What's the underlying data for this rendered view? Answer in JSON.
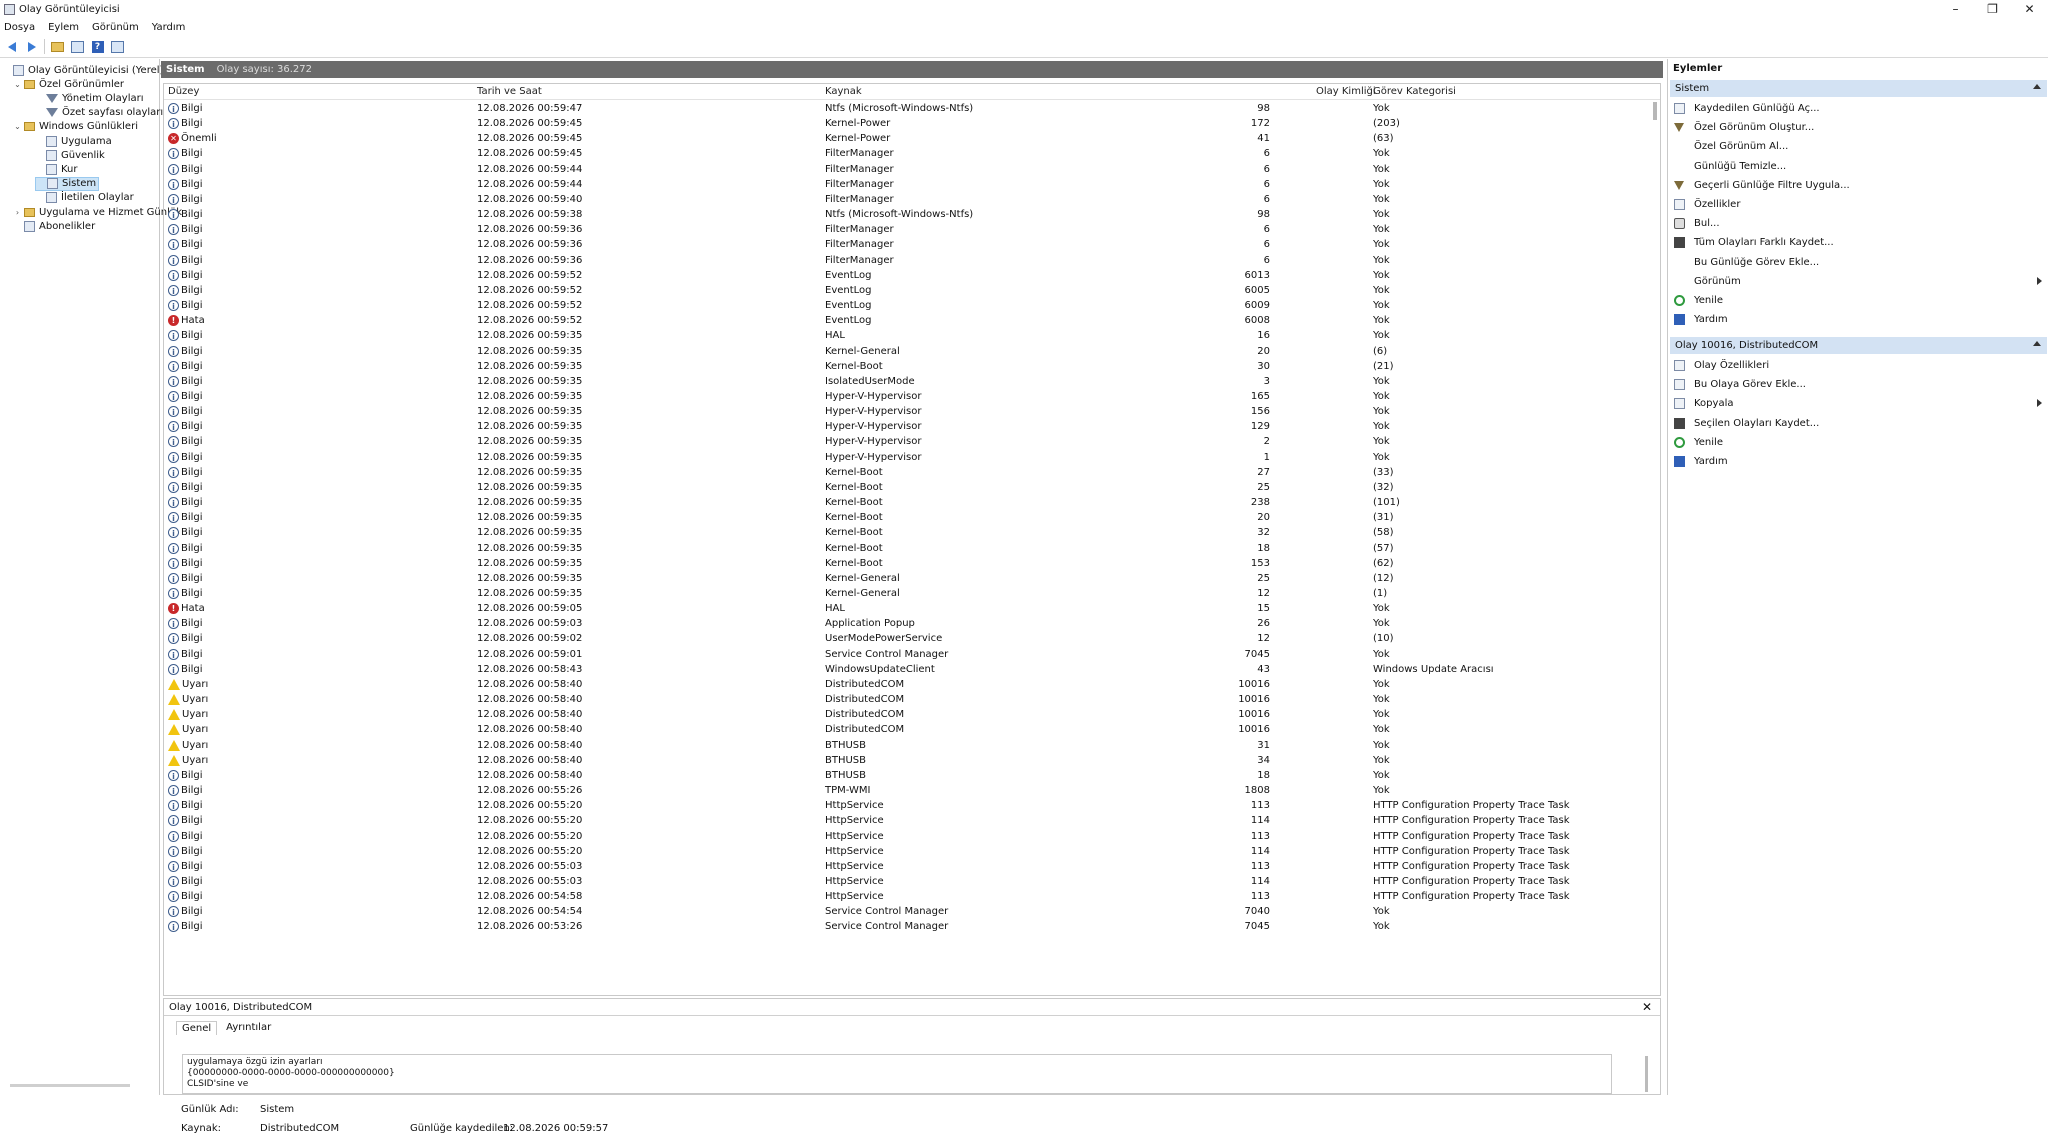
{
  "window": {
    "title": "Olay Görüntüleyicisi",
    "minimize": "–",
    "maximize": "❐",
    "close": "✕"
  },
  "menu": [
    "Dosya",
    "Eylem",
    "Görünüm",
    "Yardım"
  ],
  "tree": [
    {
      "label": "Olay Görüntüleyicisi (Yerel)",
      "indent": 0,
      "exp": "",
      "icon": "doc"
    },
    {
      "label": "Özel Görünümler",
      "indent": 1,
      "exp": "⌄",
      "icon": "folder"
    },
    {
      "label": "Yönetim Olayları",
      "indent": 3,
      "exp": "",
      "icon": "filter"
    },
    {
      "label": "Özet sayfası olayları",
      "indent": 3,
      "exp": "",
      "icon": "filter"
    },
    {
      "label": "Windows Günlükleri",
      "indent": 1,
      "exp": "⌄",
      "icon": "folder"
    },
    {
      "label": "Uygulama",
      "indent": 3,
      "exp": "",
      "icon": "doc"
    },
    {
      "label": "Güvenlik",
      "indent": 3,
      "exp": "",
      "icon": "doc"
    },
    {
      "label": "Kur",
      "indent": 3,
      "exp": "",
      "icon": "doc"
    },
    {
      "label": "Sistem",
      "indent": 3,
      "exp": "",
      "icon": "doc",
      "selected": true
    },
    {
      "label": "İletilen Olaylar",
      "indent": 3,
      "exp": "",
      "icon": "doc"
    },
    {
      "label": "Uygulama ve Hizmet Günlük",
      "indent": 1,
      "exp": "›",
      "icon": "folder"
    },
    {
      "label": "Abonelikler",
      "indent": 1,
      "exp": "",
      "icon": "doc"
    }
  ],
  "center": {
    "header_title": "Sistem",
    "header_count": "Olay sayısı: 36.272"
  },
  "columns": {
    "level": "Düzey",
    "date": "Tarih ve Saat",
    "source": "Kaynak",
    "id": "Olay Kimliği",
    "category": "Görev Kategorisi"
  },
  "events": [
    {
      "t": "info",
      "level": "Bilgi",
      "date": "12.08.2026 00:59:47",
      "source": "Ntfs (Microsoft-Windows-Ntfs)",
      "id": "98",
      "cat": "Yok"
    },
    {
      "t": "info",
      "level": "Bilgi",
      "date": "12.08.2026 00:59:45",
      "source": "Kernel-Power",
      "id": "172",
      "cat": "(203)"
    },
    {
      "t": "crit",
      "level": "Önemli",
      "date": "12.08.2026 00:59:45",
      "source": "Kernel-Power",
      "id": "41",
      "cat": "(63)"
    },
    {
      "t": "info",
      "level": "Bilgi",
      "date": "12.08.2026 00:59:45",
      "source": "FilterManager",
      "id": "6",
      "cat": "Yok"
    },
    {
      "t": "info",
      "level": "Bilgi",
      "date": "12.08.2026 00:59:44",
      "source": "FilterManager",
      "id": "6",
      "cat": "Yok"
    },
    {
      "t": "info",
      "level": "Bilgi",
      "date": "12.08.2026 00:59:44",
      "source": "FilterManager",
      "id": "6",
      "cat": "Yok"
    },
    {
      "t": "info",
      "level": "Bilgi",
      "date": "12.08.2026 00:59:40",
      "source": "FilterManager",
      "id": "6",
      "cat": "Yok"
    },
    {
      "t": "info",
      "level": "Bilgi",
      "date": "12.08.2026 00:59:38",
      "source": "Ntfs (Microsoft-Windows-Ntfs)",
      "id": "98",
      "cat": "Yok"
    },
    {
      "t": "info",
      "level": "Bilgi",
      "date": "12.08.2026 00:59:36",
      "source": "FilterManager",
      "id": "6",
      "cat": "Yok"
    },
    {
      "t": "info",
      "level": "Bilgi",
      "date": "12.08.2026 00:59:36",
      "source": "FilterManager",
      "id": "6",
      "cat": "Yok"
    },
    {
      "t": "info",
      "level": "Bilgi",
      "date": "12.08.2026 00:59:36",
      "source": "FilterManager",
      "id": "6",
      "cat": "Yok"
    },
    {
      "t": "info",
      "level": "Bilgi",
      "date": "12.08.2026 00:59:52",
      "source": "EventLog",
      "id": "6013",
      "cat": "Yok"
    },
    {
      "t": "info",
      "level": "Bilgi",
      "date": "12.08.2026 00:59:52",
      "source": "EventLog",
      "id": "6005",
      "cat": "Yok"
    },
    {
      "t": "info",
      "level": "Bilgi",
      "date": "12.08.2026 00:59:52",
      "source": "EventLog",
      "id": "6009",
      "cat": "Yok"
    },
    {
      "t": "err",
      "level": "Hata",
      "date": "12.08.2026 00:59:52",
      "source": "EventLog",
      "id": "6008",
      "cat": "Yok"
    },
    {
      "t": "info",
      "level": "Bilgi",
      "date": "12.08.2026 00:59:35",
      "source": "HAL",
      "id": "16",
      "cat": "Yok"
    },
    {
      "t": "info",
      "level": "Bilgi",
      "date": "12.08.2026 00:59:35",
      "source": "Kernel-General",
      "id": "20",
      "cat": "(6)"
    },
    {
      "t": "info",
      "level": "Bilgi",
      "date": "12.08.2026 00:59:35",
      "source": "Kernel-Boot",
      "id": "30",
      "cat": "(21)"
    },
    {
      "t": "info",
      "level": "Bilgi",
      "date": "12.08.2026 00:59:35",
      "source": "IsolatedUserMode",
      "id": "3",
      "cat": "Yok"
    },
    {
      "t": "info",
      "level": "Bilgi",
      "date": "12.08.2026 00:59:35",
      "source": "Hyper-V-Hypervisor",
      "id": "165",
      "cat": "Yok"
    },
    {
      "t": "info",
      "level": "Bilgi",
      "date": "12.08.2026 00:59:35",
      "source": "Hyper-V-Hypervisor",
      "id": "156",
      "cat": "Yok"
    },
    {
      "t": "info",
      "level": "Bilgi",
      "date": "12.08.2026 00:59:35",
      "source": "Hyper-V-Hypervisor",
      "id": "129",
      "cat": "Yok"
    },
    {
      "t": "info",
      "level": "Bilgi",
      "date": "12.08.2026 00:59:35",
      "source": "Hyper-V-Hypervisor",
      "id": "2",
      "cat": "Yok"
    },
    {
      "t": "info",
      "level": "Bilgi",
      "date": "12.08.2026 00:59:35",
      "source": "Hyper-V-Hypervisor",
      "id": "1",
      "cat": "Yok"
    },
    {
      "t": "info",
      "level": "Bilgi",
      "date": "12.08.2026 00:59:35",
      "source": "Kernel-Boot",
      "id": "27",
      "cat": "(33)"
    },
    {
      "t": "info",
      "level": "Bilgi",
      "date": "12.08.2026 00:59:35",
      "source": "Kernel-Boot",
      "id": "25",
      "cat": "(32)"
    },
    {
      "t": "info",
      "level": "Bilgi",
      "date": "12.08.2026 00:59:35",
      "source": "Kernel-Boot",
      "id": "238",
      "cat": "(101)"
    },
    {
      "t": "info",
      "level": "Bilgi",
      "date": "12.08.2026 00:59:35",
      "source": "Kernel-Boot",
      "id": "20",
      "cat": "(31)"
    },
    {
      "t": "info",
      "level": "Bilgi",
      "date": "12.08.2026 00:59:35",
      "source": "Kernel-Boot",
      "id": "32",
      "cat": "(58)"
    },
    {
      "t": "info",
      "level": "Bilgi",
      "date": "12.08.2026 00:59:35",
      "source": "Kernel-Boot",
      "id": "18",
      "cat": "(57)"
    },
    {
      "t": "info",
      "level": "Bilgi",
      "date": "12.08.2026 00:59:35",
      "source": "Kernel-Boot",
      "id": "153",
      "cat": "(62)"
    },
    {
      "t": "info",
      "level": "Bilgi",
      "date": "12.08.2026 00:59:35",
      "source": "Kernel-General",
      "id": "25",
      "cat": "(12)"
    },
    {
      "t": "info",
      "level": "Bilgi",
      "date": "12.08.2026 00:59:35",
      "source": "Kernel-General",
      "id": "12",
      "cat": "(1)"
    },
    {
      "t": "err",
      "level": "Hata",
      "date": "12.08.2026 00:59:05",
      "source": "HAL",
      "id": "15",
      "cat": "Yok"
    },
    {
      "t": "info",
      "level": "Bilgi",
      "date": "12.08.2026 00:59:03",
      "source": "Application Popup",
      "id": "26",
      "cat": "Yok"
    },
    {
      "t": "info",
      "level": "Bilgi",
      "date": "12.08.2026 00:59:02",
      "source": "UserModePowerService",
      "id": "12",
      "cat": "(10)"
    },
    {
      "t": "info",
      "level": "Bilgi",
      "date": "12.08.2026 00:59:01",
      "source": "Service Control Manager",
      "id": "7045",
      "cat": "Yok"
    },
    {
      "t": "info",
      "level": "Bilgi",
      "date": "12.08.2026 00:58:43",
      "source": "WindowsUpdateClient",
      "id": "43",
      "cat": "Windows Update Aracısı"
    },
    {
      "t": "warn",
      "level": "Uyarı",
      "date": "12.08.2026 00:58:40",
      "source": "DistributedCOM",
      "id": "10016",
      "cat": "Yok"
    },
    {
      "t": "warn",
      "level": "Uyarı",
      "date": "12.08.2026 00:58:40",
      "source": "DistributedCOM",
      "id": "10016",
      "cat": "Yok"
    },
    {
      "t": "warn",
      "level": "Uyarı",
      "date": "12.08.2026 00:58:40",
      "source": "DistributedCOM",
      "id": "10016",
      "cat": "Yok"
    },
    {
      "t": "warn",
      "level": "Uyarı",
      "date": "12.08.2026 00:58:40",
      "source": "DistributedCOM",
      "id": "10016",
      "cat": "Yok"
    },
    {
      "t": "warn",
      "level": "Uyarı",
      "date": "12.08.2026 00:58:40",
      "source": "BTHUSB",
      "id": "31",
      "cat": "Yok"
    },
    {
      "t": "warn",
      "level": "Uyarı",
      "date": "12.08.2026 00:58:40",
      "source": "BTHUSB",
      "id": "34",
      "cat": "Yok"
    },
    {
      "t": "info",
      "level": "Bilgi",
      "date": "12.08.2026 00:58:40",
      "source": "BTHUSB",
      "id": "18",
      "cat": "Yok"
    },
    {
      "t": "info",
      "level": "Bilgi",
      "date": "12.08.2026 00:55:26",
      "source": "TPM-WMI",
      "id": "1808",
      "cat": "Yok"
    },
    {
      "t": "info",
      "level": "Bilgi",
      "date": "12.08.2026 00:55:20",
      "source": "HttpService",
      "id": "113",
      "cat": "HTTP Configuration Property Trace Task"
    },
    {
      "t": "info",
      "level": "Bilgi",
      "date": "12.08.2026 00:55:20",
      "source": "HttpService",
      "id": "114",
      "cat": "HTTP Configuration Property Trace Task"
    },
    {
      "t": "info",
      "level": "Bilgi",
      "date": "12.08.2026 00:55:20",
      "source": "HttpService",
      "id": "113",
      "cat": "HTTP Configuration Property Trace Task"
    },
    {
      "t": "info",
      "level": "Bilgi",
      "date": "12.08.2026 00:55:20",
      "source": "HttpService",
      "id": "114",
      "cat": "HTTP Configuration Property Trace Task"
    },
    {
      "t": "info",
      "level": "Bilgi",
      "date": "12.08.2026 00:55:03",
      "source": "HttpService",
      "id": "113",
      "cat": "HTTP Configuration Property Trace Task"
    },
    {
      "t": "info",
      "level": "Bilgi",
      "date": "12.08.2026 00:55:03",
      "source": "HttpService",
      "id": "114",
      "cat": "HTTP Configuration Property Trace Task"
    },
    {
      "t": "info",
      "level": "Bilgi",
      "date": "12.08.2026 00:54:58",
      "source": "HttpService",
      "id": "113",
      "cat": "HTTP Configuration Property Trace Task"
    },
    {
      "t": "info",
      "level": "Bilgi",
      "date": "12.08.2026 00:54:54",
      "source": "Service Control Manager",
      "id": "7040",
      "cat": "Yok"
    },
    {
      "t": "info",
      "level": "Bilgi",
      "date": "12.08.2026 00:53:26",
      "source": "Service Control Manager",
      "id": "7045",
      "cat": "Yok"
    }
  ],
  "detail": {
    "title": "Olay 10016, DistributedCOM",
    "close": "✕",
    "tabs": [
      "Genel",
      "Ayrıntılar"
    ],
    "desc_lines": [
      "uygulamaya özgü izin ayarları",
      "{00000000-0000-0000-0000-000000000000}",
      "CLSID'sine ve"
    ],
    "log_name_label": "Günlük Adı:",
    "log_name": "Sistem",
    "source_label": "Kaynak:",
    "source": "DistributedCOM",
    "logged_label": "Günlüğe kaydedilen:",
    "logged": "12.08.2026 00:59:57"
  },
  "actions": {
    "title": "Eylemler",
    "section1": "Sistem",
    "items1": [
      {
        "label": "Kaydedilen Günlüğü Aç...",
        "icon": "folder"
      },
      {
        "label": "Özel Görünüm Oluştur...",
        "icon": "filter"
      },
      {
        "label": "Özel Görünüm Al...",
        "icon": "blank"
      },
      {
        "label": "Günlüğü Temizle...",
        "icon": "blank"
      },
      {
        "label": "Geçerli Günlüğe Filtre Uygula...",
        "icon": "filter"
      },
      {
        "label": "Özellikler",
        "icon": "doc"
      },
      {
        "label": "Bul...",
        "icon": "find"
      },
      {
        "label": "Tüm Olayları Farklı Kaydet...",
        "icon": "save"
      },
      {
        "label": "Bu Günlüğe Görev Ekle...",
        "icon": "blank"
      },
      {
        "label": "Görünüm",
        "icon": "blank",
        "sub": true
      },
      {
        "label": "Yenile",
        "icon": "refresh"
      },
      {
        "label": "Yardım",
        "icon": "help"
      }
    ],
    "section2": "Olay 10016, DistributedCOM",
    "items2": [
      {
        "label": "Olay Özellikleri",
        "icon": "doc"
      },
      {
        "label": "Bu Olaya Görev Ekle...",
        "icon": "doc"
      },
      {
        "label": "Kopyala",
        "icon": "doc",
        "sub": true
      },
      {
        "label": "Seçilen Olayları Kaydet...",
        "icon": "save"
      },
      {
        "label": "Yenile",
        "icon": "refresh"
      },
      {
        "label": "Yardım",
        "icon": "help"
      }
    ]
  }
}
